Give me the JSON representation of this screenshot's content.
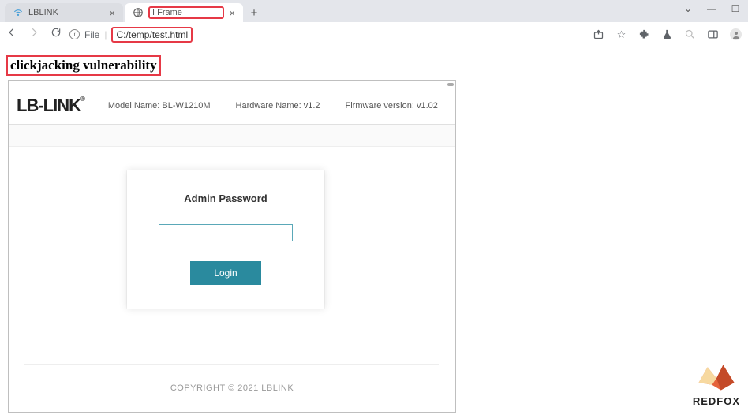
{
  "browser": {
    "tabs": [
      {
        "title": "LBLINK",
        "active": false
      },
      {
        "title": "I Frame",
        "active": true
      }
    ],
    "url": {
      "scheme_label": "File",
      "path": "C:/temp/test.html"
    }
  },
  "page_heading": "clickjacking vulnerability",
  "router": {
    "brand": "LB-LINK",
    "model_label": "Model Name:",
    "model": "BL-W1210M",
    "hw_label": "Hardware Name:",
    "hw": "v1.2",
    "fw_label": "Firmware version:",
    "fw": "v1.02",
    "login_title": "Admin Password",
    "login_button": "Login",
    "copyright": "COPYRIGHT © 2021 LBLINK"
  },
  "watermark": {
    "text": "REDFOX"
  }
}
